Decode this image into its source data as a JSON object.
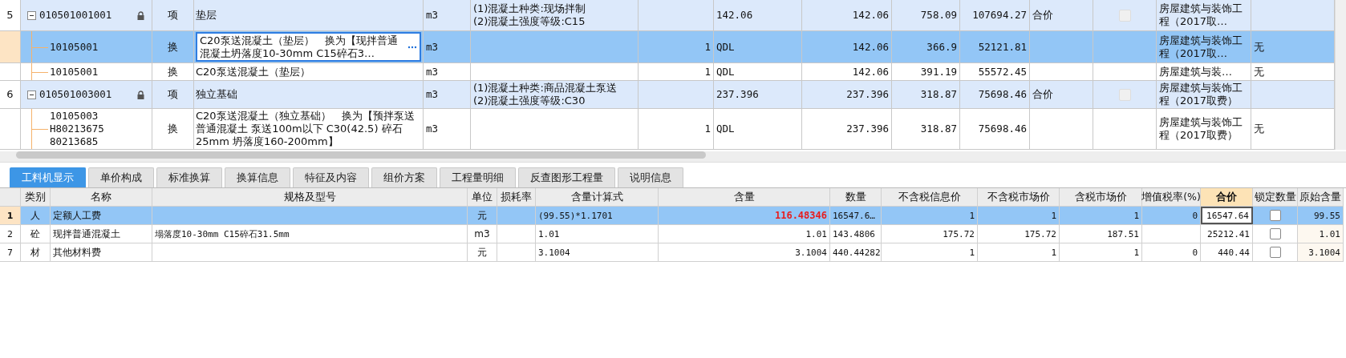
{
  "top_table": {
    "rows": [
      {
        "kind": "item",
        "row_no": "5",
        "expanded": true,
        "locked": true,
        "code_lines": [
          "010501001001"
        ],
        "type": "项",
        "name": "垫层",
        "unit": "m3",
        "features": [
          "(1)混凝土种类:现场拌制",
          "(2)混凝土强度等级:C15"
        ],
        "qdl": "142.06",
        "quantity": "142.06",
        "unit_price": "758.09",
        "total": "107694.27",
        "price_mode": "合价",
        "checked": false,
        "fee": "房屋建筑与装饰工程（2017取…",
        "selected": false,
        "editing": false
      },
      {
        "kind": "sub",
        "code_lines": [
          "10105001"
        ],
        "type": "换",
        "name": "C20泵送混凝土（垫层）　换为【现拌普通混凝土坍落度10-30mm C15碎石3…",
        "unit": "m3",
        "content": "1",
        "qdl": "QDL",
        "quantity": "142.06",
        "unit_price": "366.9",
        "total": "52121.81",
        "fee": "房屋建筑与装饰工程（2017取…",
        "extra": "无",
        "selected": true,
        "editing": true
      },
      {
        "kind": "sub",
        "code_lines": [
          "10105001"
        ],
        "type": "换",
        "name": "C20泵送混凝土（垫层）",
        "unit": "m3",
        "content": "1",
        "qdl": "QDL",
        "quantity": "142.06",
        "unit_price": "391.19",
        "total": "55572.45",
        "fee": "房屋建筑与装…",
        "extra": "无",
        "selected": false,
        "editing": false
      },
      {
        "kind": "item",
        "row_no": "6",
        "expanded": true,
        "locked": true,
        "code_lines": [
          "010501003001"
        ],
        "type": "项",
        "name": "独立基础",
        "unit": "m3",
        "features": [
          "(1)混凝土种类:商品混凝土泵送",
          "(2)混凝土强度等级:C30"
        ],
        "qdl": "237.396",
        "quantity": "237.396",
        "unit_price": "318.87",
        "total": "75698.46",
        "price_mode": "合价",
        "checked": false,
        "fee": "房屋建筑与装饰工程（2017取费）",
        "selected": false,
        "editing": false
      },
      {
        "kind": "sub",
        "code_lines": [
          "10105003",
          "H80213675",
          "80213685"
        ],
        "type": "换",
        "name": "C20泵送混凝土（独立基础）　换为【预拌泵送普通混凝土 泵送100m以下 C30(42.5) 碎石25mm 坍落度160-200mm】",
        "unit": "m3",
        "content": "1",
        "qdl": "QDL",
        "quantity": "237.396",
        "unit_price": "318.87",
        "total": "75698.46",
        "fee": "房屋建筑与装饰工程（2017取费）",
        "extra": "无",
        "selected": false,
        "editing": false
      }
    ]
  },
  "tabs": [
    {
      "label": "工料机显示",
      "selected": true
    },
    {
      "label": "单价构成",
      "selected": false
    },
    {
      "label": "标准换算",
      "selected": false
    },
    {
      "label": "换算信息",
      "selected": false
    },
    {
      "label": "特征及内容",
      "selected": false
    },
    {
      "label": "组价方案",
      "selected": false
    },
    {
      "label": "工程量明细",
      "selected": false
    },
    {
      "label": "反查图形工程量",
      "selected": false
    },
    {
      "label": "说明信息",
      "selected": false
    }
  ],
  "resource_table": {
    "columns": [
      {
        "label": "类别",
        "highlighted": false
      },
      {
        "label": "名称",
        "highlighted": false
      },
      {
        "label": "规格及型号",
        "highlighted": false
      },
      {
        "label": "单位",
        "highlighted": false
      },
      {
        "label": "损耗率",
        "highlighted": false
      },
      {
        "label": "含量计算式",
        "highlighted": false
      },
      {
        "label": "含量",
        "highlighted": false
      },
      {
        "label": "数量",
        "highlighted": false
      },
      {
        "label": "不含税信息价",
        "highlighted": false
      },
      {
        "label": "不含税市场价",
        "highlighted": false
      },
      {
        "label": "含税市场价",
        "highlighted": false
      },
      {
        "label": "增值税率(%)",
        "highlighted": false
      },
      {
        "label": "合价",
        "highlighted": true
      },
      {
        "label": "锁定数量",
        "highlighted": false
      },
      {
        "label": "原始含量",
        "highlighted": false
      }
    ],
    "rows": [
      {
        "row_no": "1",
        "category": "人",
        "name": "定额人工费",
        "unit": "元",
        "formula": "(99.55)*1.1701",
        "content": "116.48346",
        "content_changed": true,
        "quantity": "16547.6…",
        "info_price": "1",
        "market_price": "1",
        "tax_price": "1",
        "vat": "0",
        "total": "16547.64",
        "total_editing": true,
        "locked": false,
        "original": "99.55",
        "selected": true
      },
      {
        "row_no": "2",
        "category": "砼",
        "name": "现拌普通混凝土",
        "spec": "塌落度10-30mm C15碎石31.5mm",
        "unit": "m3",
        "formula": "1.01",
        "content": "1.01",
        "content_changed": false,
        "quantity": "143.4806",
        "info_price": "175.72",
        "market_price": "175.72",
        "tax_price": "187.51",
        "total": "25212.41",
        "total_editing": false,
        "locked": false,
        "original": "1.01",
        "selected": false
      },
      {
        "row_no": "7",
        "category": "材",
        "name": "其他材料费",
        "unit": "元",
        "formula": "3.1004",
        "content": "3.1004",
        "content_changed": false,
        "quantity": "440.44282",
        "info_price": "1",
        "market_price": "1",
        "tax_price": "1",
        "vat": "0",
        "total": "440.44",
        "total_editing": false,
        "locked": false,
        "original": "3.1004",
        "selected": false
      }
    ]
  }
}
